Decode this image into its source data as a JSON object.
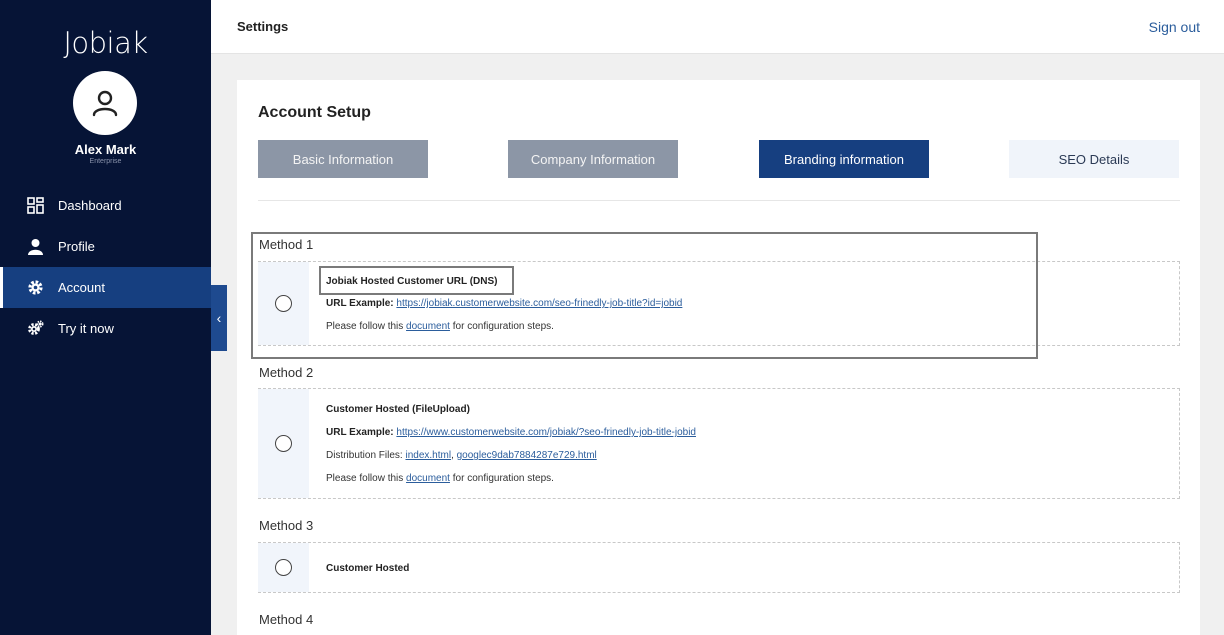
{
  "app": {
    "logo": "Jobiak",
    "user_name": "Alex Mark",
    "user_tier": "Enterprise"
  },
  "sidebar": {
    "items": [
      {
        "label": "Dashboard",
        "icon": "dashboard-grid-icon"
      },
      {
        "label": "Profile",
        "icon": "person-icon"
      },
      {
        "label": "Account",
        "icon": "gear-icon"
      },
      {
        "label": "Try it now",
        "icon": "gears-icon"
      }
    ],
    "collapse_glyph": "‹"
  },
  "header": {
    "title": "Settings",
    "signout": "Sign out"
  },
  "account": {
    "title": "Account Setup",
    "tabs": [
      {
        "label": "Basic Information"
      },
      {
        "label": "Company Information"
      },
      {
        "label": "Branding information"
      },
      {
        "label": "SEO Details"
      }
    ]
  },
  "methods": {
    "m1": {
      "label": "Method 1",
      "title": "Jobiak Hosted Customer URL (DNS)",
      "url_label": "URL Example:",
      "url": "https://jobiak.customerwebsite.com/seo-frinedly-job-title?id=jobid",
      "follow_pre": "Please follow this",
      "follow_link": "document",
      "follow_post": "for configuration steps."
    },
    "m2": {
      "label": "Method 2",
      "title": "Customer Hosted (FileUpload)",
      "url_label": "URL Example:",
      "url": "https://www.customerwebsite.com/jobiak/?seo-frinedly-job-title-jobid",
      "dist_label": "Distribution Files:",
      "dist_file1": "index.html",
      "dist_sep": ",",
      "dist_file2": "googlec9dab7884287e729.html",
      "follow_pre": "Please follow this",
      "follow_link": "document",
      "follow_post": "for configuration steps."
    },
    "m3": {
      "label": "Method 3",
      "title": "Customer Hosted"
    },
    "m4": {
      "label": "Method 4"
    }
  },
  "colors": {
    "sidebar_bg": "#061436",
    "active_blue": "#163f80",
    "link": "#2b5d9c"
  }
}
